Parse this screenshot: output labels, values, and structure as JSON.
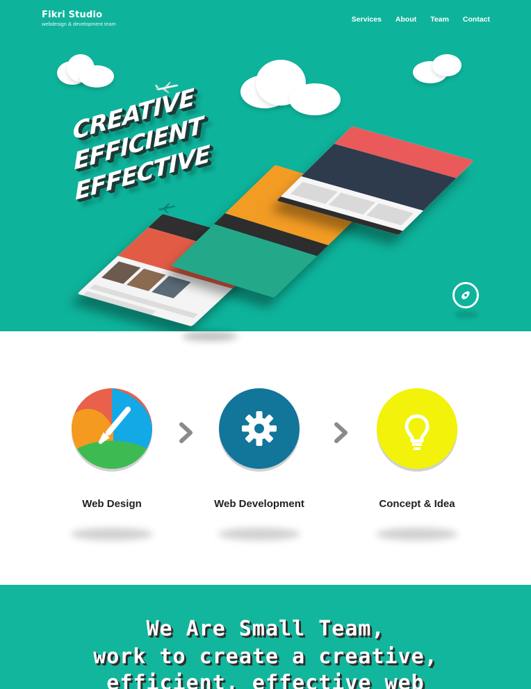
{
  "header": {
    "brand_title": "Fikri Studio",
    "brand_tagline": "webdesign & development team",
    "nav": [
      {
        "label": "Services"
      },
      {
        "label": "About"
      },
      {
        "label": "Team"
      },
      {
        "label": "Contact"
      }
    ]
  },
  "hero": {
    "slogan": [
      "CREATIVE",
      "EFFICIENT",
      "EFFECTIVE"
    ],
    "compass_icon": "compass-icon",
    "bg_color": "#0eb39b"
  },
  "services": {
    "items": [
      {
        "label": "Web Design",
        "icon": "paintbrush-icon"
      },
      {
        "label": "Web Development",
        "icon": "gear-icon"
      },
      {
        "label": "Concept & Idea",
        "icon": "lightbulb-icon"
      }
    ],
    "colors": {
      "web_dev": "#12759a",
      "concept": "#f2f20b",
      "arrow": "#8a8a8a"
    }
  },
  "team": {
    "lines": [
      "We Are Small Team,",
      "work to create a creative,",
      "efficient, effective web"
    ],
    "bg_color": "#12b69d"
  }
}
